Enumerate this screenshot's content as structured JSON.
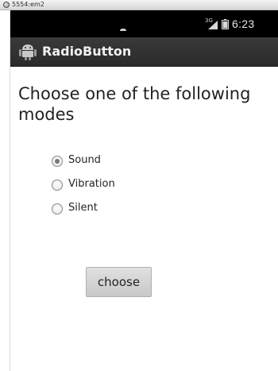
{
  "emulator": {
    "title": "5554:em2"
  },
  "status_bar": {
    "network_type": "3G",
    "time": "6:23"
  },
  "action_bar": {
    "title": "RadioButton",
    "icon": "android-app-icon"
  },
  "main": {
    "heading": "Choose one of the following modes",
    "radio_options": [
      {
        "label": "Sound",
        "checked": true
      },
      {
        "label": "Vibration",
        "checked": false
      },
      {
        "label": "Silent",
        "checked": false
      }
    ],
    "button_label": "choose"
  }
}
